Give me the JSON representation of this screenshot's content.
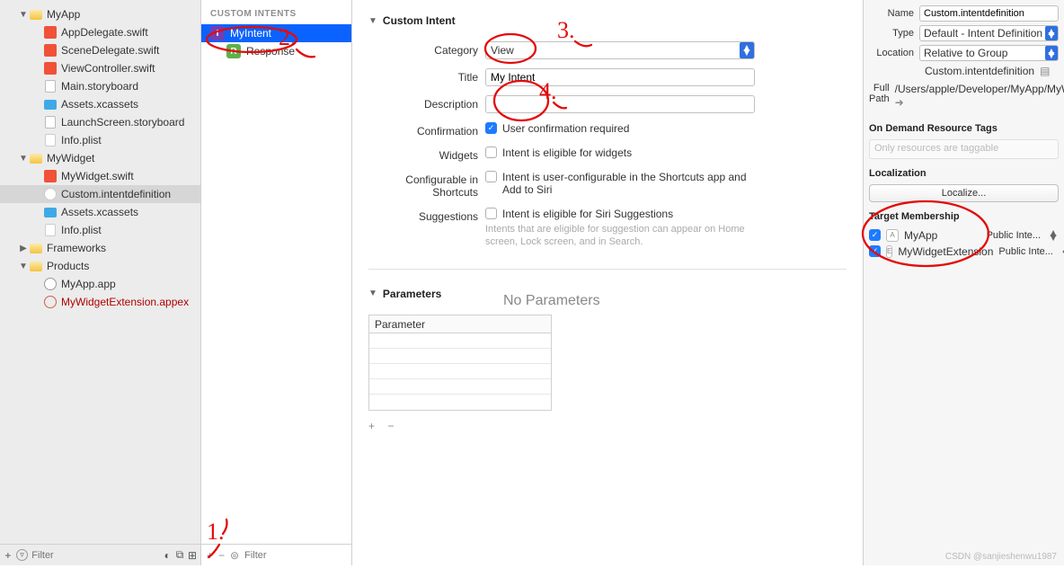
{
  "navigator": {
    "groups": [
      {
        "name": "MyApp",
        "expanded": true,
        "children": [
          {
            "file": "AppDelegate.swift",
            "kind": "swift"
          },
          {
            "file": "SceneDelegate.swift",
            "kind": "swift"
          },
          {
            "file": "ViewController.swift",
            "kind": "swift"
          },
          {
            "file": "Main.storyboard",
            "kind": "story"
          },
          {
            "file": "Assets.xcassets",
            "kind": "assets"
          },
          {
            "file": "LaunchScreen.storyboard",
            "kind": "story"
          },
          {
            "file": "Info.plist",
            "kind": "plist"
          }
        ]
      },
      {
        "name": "MyWidget",
        "expanded": true,
        "children": [
          {
            "file": "MyWidget.swift",
            "kind": "swift"
          },
          {
            "file": "Custom.intentdefinition",
            "kind": "intent",
            "selected": true
          },
          {
            "file": "Assets.xcassets",
            "kind": "assets"
          },
          {
            "file": "Info.plist",
            "kind": "plist"
          }
        ]
      },
      {
        "name": "Frameworks",
        "expanded": false
      },
      {
        "name": "Products",
        "expanded": true,
        "children": [
          {
            "file": "MyApp.app",
            "kind": "app"
          },
          {
            "file": "MyWidgetExtension.appex",
            "kind": "appex",
            "red": true
          }
        ]
      }
    ],
    "filter_placeholder": "Filter"
  },
  "intents": {
    "header": "CUSTOM INTENTS",
    "items": [
      {
        "name": "MyIntent",
        "badge": "I",
        "selected": true
      },
      {
        "name": "Response",
        "badge": "R",
        "sub": true
      }
    ],
    "filter_placeholder": "Filter"
  },
  "editor": {
    "section1": "Custom Intent",
    "category_label": "Category",
    "category_value": "View",
    "title_label": "Title",
    "title_value": "My Intent",
    "description_label": "Description",
    "description_value": "",
    "confirmation_label": "Confirmation",
    "confirmation_checked": true,
    "confirmation_text": "User confirmation required",
    "widgets_label": "Widgets",
    "widgets_text": "Intent is eligible for widgets",
    "shortcuts_label": "Configurable in Shortcuts",
    "shortcuts_text": "Intent is user-configurable in the Shortcuts app and Add to Siri",
    "suggestions_label": "Suggestions",
    "suggestions_text": "Intent is eligible for Siri Suggestions",
    "suggestions_hint": "Intents that are eligible for suggestion can appear on Home screen, Lock screen, and in Search.",
    "section2": "Parameters",
    "param_header": "Parameter",
    "no_params": "No Parameters"
  },
  "inspector": {
    "name_label": "Name",
    "name_value": "Custom.intentdefinition",
    "type_label": "Type",
    "type_value": "Default - Intent Definition",
    "location_label": "Location",
    "location_value": "Relative to Group",
    "location_path": "Custom.intentdefinition",
    "fullpath_label": "Full Path",
    "fullpath_value": "/Users/apple/Developer/MyApp/MyWidget/Custom.intentdefinition",
    "resource_tags_title": "On Demand Resource Tags",
    "resource_tags_placeholder": "Only resources are taggable",
    "localization_title": "Localization",
    "localize_btn": "Localize...",
    "tm_title": "Target Membership",
    "tm_items": [
      {
        "name": "MyApp",
        "vis": "Public Inte..."
      },
      {
        "name": "MyWidgetExtension",
        "vis": "Public Inte..."
      }
    ]
  },
  "watermark": "CSDN @sanjieshenwu1987"
}
